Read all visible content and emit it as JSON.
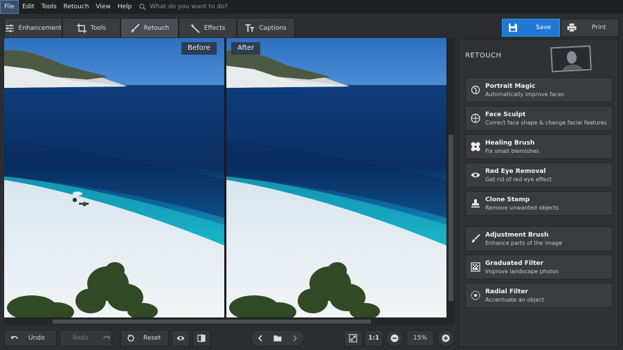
{
  "menu": {
    "items": [
      "File",
      "Edit",
      "Tools",
      "Retouch",
      "View",
      "Help"
    ],
    "search_placeholder": "What do you want to do?"
  },
  "tabs": [
    {
      "label": "Enhancement",
      "icon": "sliders-icon"
    },
    {
      "label": "Tools",
      "icon": "crop-icon"
    },
    {
      "label": "Retouch",
      "icon": "brush-icon"
    },
    {
      "label": "Effects",
      "icon": "magic-wand-icon"
    },
    {
      "label": "Captions",
      "icon": "text-icon"
    }
  ],
  "active_tab": "Retouch",
  "actions": {
    "save_label": "Save",
    "print_label": "Print"
  },
  "preview": {
    "before_label": "Before",
    "after_label": "After"
  },
  "bottom": {
    "undo_label": "Undo",
    "redo_label": "Redo",
    "reset_label": "Reset",
    "ratio_label": "1:1",
    "zoom_value": "15%"
  },
  "panel": {
    "title": "RETOUCH",
    "tools": [
      {
        "title": "Portrait Magic",
        "desc": "Automatically improve faces",
        "icon": "magic-face-icon"
      },
      {
        "title": "Face Sculpt",
        "desc": "Correct face shape & change facial features",
        "icon": "face-sculpt-icon"
      },
      {
        "title": "Healing Brush",
        "desc": "Fix small blemishes",
        "icon": "bandage-icon"
      },
      {
        "title": "Red Eye Removal",
        "desc": "Get rid of red eye effect",
        "icon": "eye-icon"
      },
      {
        "title": "Clone Stamp",
        "desc": "Remove unwanted objects",
        "icon": "stamp-icon"
      },
      {
        "title": "Adjustment Brush",
        "desc": "Enhance parts of the image",
        "icon": "brush-icon"
      },
      {
        "title": "Graduated Filter",
        "desc": "Improve landscape photos",
        "icon": "gradient-icon"
      },
      {
        "title": "Radial Filter",
        "desc": "Accentuate an object",
        "icon": "radial-icon"
      }
    ]
  },
  "colors": {
    "accent": "#1e78d4",
    "panel_bg": "#2f3134",
    "badge_bg": "#2d3d52"
  }
}
